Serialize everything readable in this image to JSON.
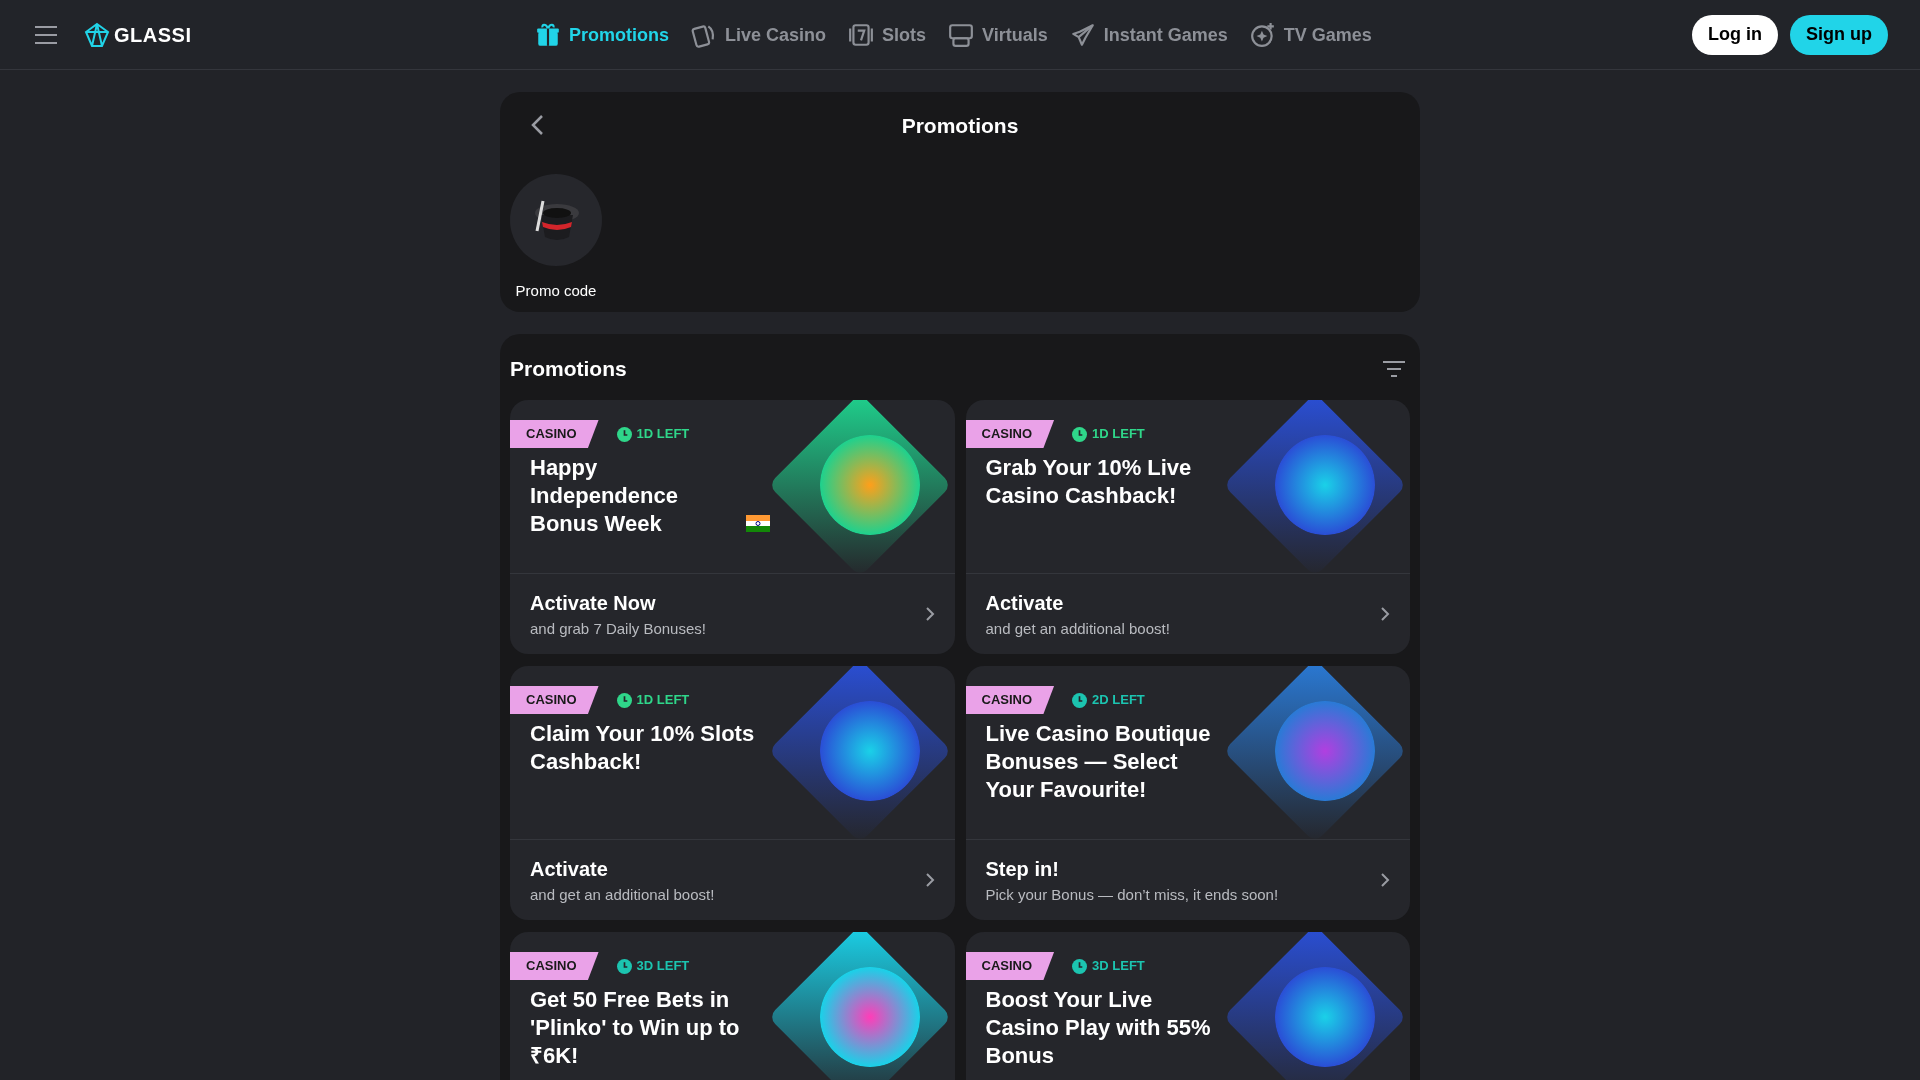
{
  "header": {
    "logo": "GLASSI",
    "nav": [
      {
        "label": "Promotions",
        "selected": true
      },
      {
        "label": "Live Casino",
        "selected": false
      },
      {
        "label": "Slots",
        "selected": false
      },
      {
        "label": "Virtuals",
        "selected": false
      },
      {
        "label": "Instant Games",
        "selected": false
      },
      {
        "label": "TV Games",
        "selected": false
      }
    ],
    "login": "Log in",
    "signup": "Sign up"
  },
  "top_panel": {
    "title": "Promotions",
    "shortcuts": [
      {
        "label": "Promo code"
      }
    ]
  },
  "promotions": {
    "title": "Promotions",
    "cards": [
      {
        "tag": "CASINO",
        "time_left": "1D LEFT",
        "color": "#2fd68a",
        "title": "Happy Independence Bonus Week",
        "flag": true,
        "action": "Activate Now",
        "subtitle": "and grab 7 Daily Bonuses!"
      },
      {
        "tag": "CASINO",
        "time_left": "1D LEFT",
        "color": "#2fd68a",
        "title": "Grab Your 10% Live Casino Cashback!",
        "flag": false,
        "action": "Activate",
        "subtitle": "and get an additional boost!"
      },
      {
        "tag": "CASINO",
        "time_left": "1D LEFT",
        "color": "#2fd68a",
        "title": "Claim Your 10% Slots Cashback!",
        "flag": false,
        "action": "Activate",
        "subtitle": "and get an additional boost!"
      },
      {
        "tag": "CASINO",
        "time_left": "2D LEFT",
        "color": "#1cc4b0",
        "title": "Live Casino Boutique Bonuses — Select Your Favourite!",
        "flag": false,
        "action": "Step in!",
        "subtitle": "Pick your Bonus — don’t miss, it ends soon!"
      },
      {
        "tag": "CASINO",
        "time_left": "3D LEFT",
        "color": "#1cc4b0",
        "title": "Get 50 Free Bets in 'Plinko' to Win up to ₹6K!",
        "flag": false
      },
      {
        "tag": "CASINO",
        "time_left": "3D LEFT",
        "color": "#1cc4b0",
        "title": "Boost Your Live Casino Play with 55% Bonus",
        "flag": false
      }
    ]
  }
}
